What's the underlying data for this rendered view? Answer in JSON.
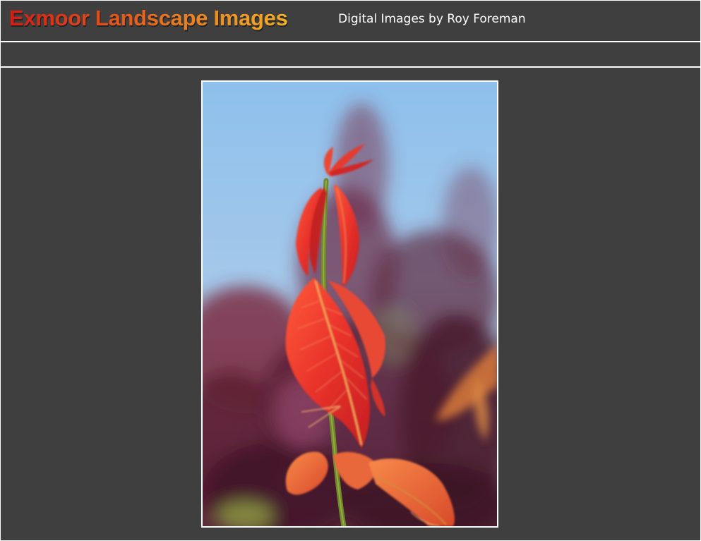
{
  "header": {
    "site_title": "Exmoor Landscape Images",
    "subtitle": "Digital Images by Roy Foreman"
  },
  "photo": {
    "subject": "red-leaf-shoot-photo"
  },
  "colors": {
    "background": "#3f3f3f",
    "rule": "#ffffff",
    "title_gradient_start": "#d81c14",
    "title_gradient_end": "#f3b025"
  }
}
